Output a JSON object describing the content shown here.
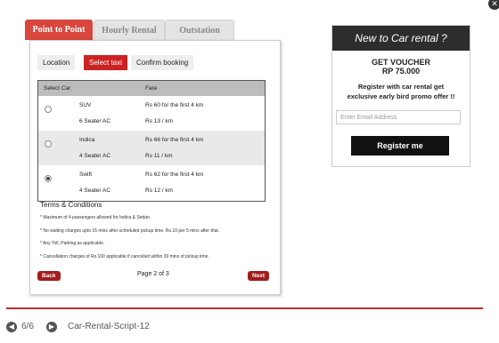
{
  "tabs": [
    {
      "label": "Point to Point"
    },
    {
      "label": "Hourly Rental"
    },
    {
      "label": "Outstation"
    }
  ],
  "subtabs": [
    {
      "label": "Location"
    },
    {
      "label": "Select taxi"
    },
    {
      "label": "Confirm booking"
    }
  ],
  "grid": {
    "headers": {
      "car": "Select Car",
      "fare": "Fare"
    },
    "rows": [
      {
        "name": "SUV",
        "seats": "6 Seater AC",
        "fare": "Rs 60 for the first 4 km",
        "rate": "Rs 13 / km",
        "selected": false
      },
      {
        "name": "Indica",
        "seats": "4 Seater AC",
        "fare": "Rs 66 for the first 4 km",
        "rate": "Rs 11 / km",
        "selected": false
      },
      {
        "name": "Swift",
        "seats": "4 Seater AC",
        "fare": "Rs 62 for the first 4 km",
        "rate": "Rs 12 / km",
        "selected": true
      }
    ]
  },
  "terms": {
    "title": "Terms & Conditions",
    "items": [
      "* Maximum of 4 passengers allowed for Indica & Sedan.",
      "* No waiting charges upto 15 mins after scheduled pickup time. Rs.10 per 5 mins after that.",
      "* Any Toll, Parking as applicable.",
      "* Cancellation charges of Rs.100 applicable if cancelled within 30 mins of pickup time."
    ]
  },
  "pager": {
    "back": "Back",
    "page": "Page 2 of 3",
    "next": "Next"
  },
  "promo": {
    "heading": "New to Car rental ?",
    "voucher_title": "GET VOUCHER",
    "voucher_amount": "RP 75.000",
    "message_line1": "Register with car rental get",
    "message_line2": "exclusive early bird promo offer !!",
    "email_placeholder": "Enter Email Address",
    "register_label": "Register me"
  },
  "footer": {
    "counter": "6/6",
    "title": "Car-Rental-Script-12"
  },
  "colors": {
    "accent": "#d9463c",
    "dark": "#2d2d2d",
    "button": "#a31d1d"
  }
}
